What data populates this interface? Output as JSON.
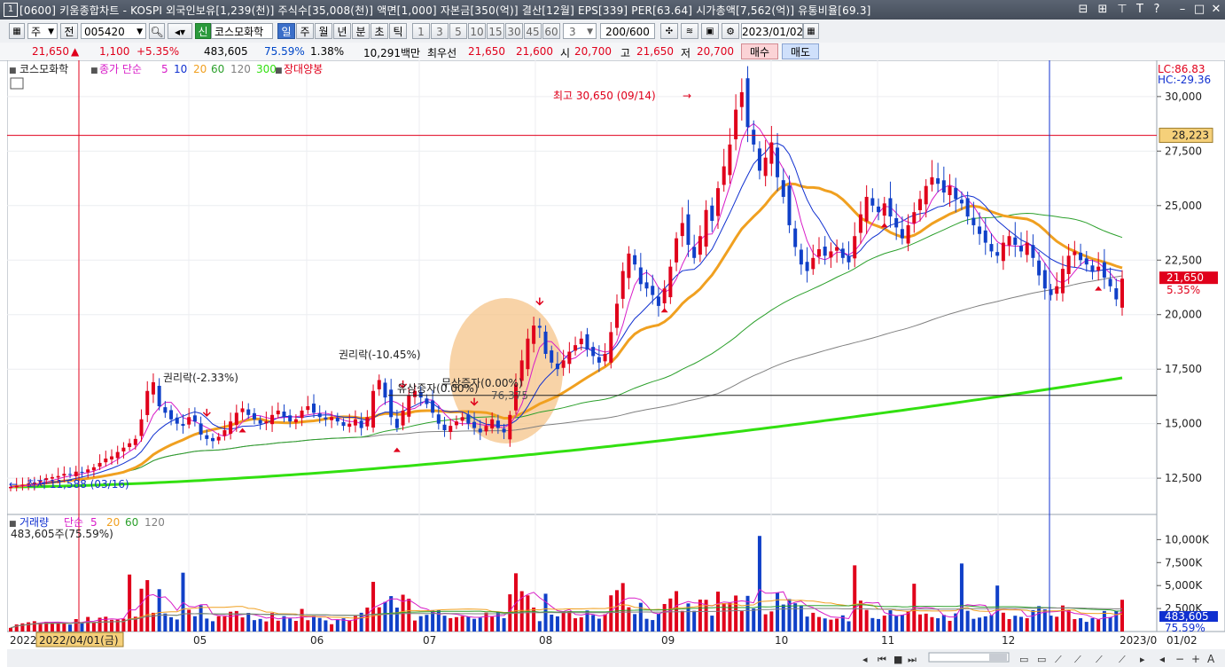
{
  "titlebar": {
    "number": "1",
    "title": "[0600] 키움종합차트 - KOSPI 외국인보유[1,239(천)] 주식수[35,008(천)] 액면[1,000] 자본금[350(억)] 결산[12월] EPS[339] PER[63.64] 시가총액[7,562(억)] 유통비율[69.3]"
  },
  "toolbar": {
    "period_unit": "주",
    "prev_label": "전",
    "code": "005420",
    "credit_label": "신",
    "stock_name": "코스모화학",
    "tabs": [
      "일",
      "주",
      "월",
      "년",
      "분",
      "초",
      "틱"
    ],
    "active_tab": "일",
    "intervals": [
      "1",
      "3",
      "5",
      "10",
      "15",
      "30",
      "45",
      "60"
    ],
    "interval_custom": "3",
    "count": "200",
    "count_max": "/600",
    "date": "2023/01/02"
  },
  "pricebar": {
    "price": "21,650",
    "change": "1,100",
    "change_pct": "+5.35%",
    "volume": "483,605",
    "volume_ratio": "75.59%",
    "turnover": "1.38%",
    "amount": "10,291백만",
    "best_label": "최우선",
    "ask": "21,650",
    "bid": "21,600",
    "open_label": "시",
    "open": "20,700",
    "high_label": "고",
    "high": "21,650",
    "low_label": "저",
    "low": "20,700",
    "buy_label": "매수",
    "sell_label": "매도"
  },
  "legend": {
    "name": "코스모화학",
    "ma_label": "종가 단순",
    "ma_periods": [
      "5",
      "10",
      "20",
      "60",
      "120",
      "300"
    ],
    "candle_type": "장대양봉"
  },
  "vol_legend": {
    "name": "거래량",
    "ma_label": "단순",
    "ma_periods": [
      "5",
      "20",
      "60",
      "120"
    ],
    "current": "483,605주(75.59%)"
  },
  "right_info": {
    "lc": "LC:86.83",
    "hc": "HC:-29.36",
    "hline_value": "28,223",
    "last_price": "21,650",
    "last_pct": "5.35%",
    "last_volume": "483,605",
    "last_vol_pct": "75.59%"
  },
  "annotations": {
    "max": "최고 30,650 (09/14)",
    "min": "최저 11,588 (03/16)",
    "rights1": "권리락(-2.33%)",
    "rights2": "권리락(-10.45%)",
    "rights_issue": "유상증자(0.00%)",
    "bonus_issue": "무상증자(0.00%)",
    "bonus_val": "76,375"
  },
  "x_axis": {
    "start": "2022",
    "cursor_date": "2022/04/01(금)",
    "months": [
      "05",
      "06",
      "07",
      "08",
      "09",
      "10",
      "11",
      "12"
    ],
    "end1": "2023/0",
    "end2": "01/02"
  },
  "colors": {
    "up": "#e0001b",
    "down": "#1040c8",
    "ma5": "#d81cc8",
    "ma10": "#1030d0",
    "ma20": "#f0a020",
    "ma60": "#2ca02c",
    "ma120": "#808080",
    "ma300": "#32e010"
  },
  "chart_data": {
    "type": "candlestick",
    "ylim": [
      11000,
      31500
    ],
    "yticks": [
      12500,
      15000,
      17500,
      20000,
      22500,
      25000,
      27500,
      30000
    ],
    "ytick_labels": [
      "12,500",
      "15,000",
      "17,500",
      "20,000",
      "22,500",
      "25,000",
      "27,500",
      "30,000"
    ],
    "hline": 28223,
    "support_line": 16300,
    "closes": [
      12100,
      12150,
      12200,
      12250,
      12300,
      12400,
      12500,
      12550,
      12600,
      12700,
      12650,
      12800,
      12750,
      12900,
      13000,
      13200,
      13400,
      13500,
      13700,
      13900,
      14100,
      14300,
      15200,
      16500,
      16900,
      15800,
      15500,
      15200,
      15000,
      14900,
      15300,
      15100,
      14500,
      14300,
      14200,
      14400,
      14700,
      15100,
      15500,
      15700,
      15400,
      15200,
      15000,
      15100,
      15400,
      15600,
      15300,
      15100,
      15200,
      15600,
      15800,
      15500,
      15300,
      15200,
      15300,
      15100,
      14900,
      15000,
      15200,
      14800,
      15300,
      16500,
      17000,
      16200,
      15300,
      14800,
      15600,
      16300,
      16500,
      16200,
      15900,
      15500,
      15000,
      14700,
      14900,
      15100,
      15300,
      15000,
      14800,
      14600,
      14900,
      15200,
      14800,
      14600,
      15400,
      16800,
      17900,
      18900,
      19500,
      19400,
      18200,
      17800,
      17500,
      17900,
      18300,
      18600,
      18900,
      18400,
      18100,
      17800,
      18200,
      19200,
      20500,
      22000,
      22800,
      22300,
      21400,
      21200,
      20900,
      20400,
      21200,
      22200,
      23500,
      24200,
      23200,
      22600,
      23600,
      24800,
      24300,
      25800,
      26800,
      27800,
      29400,
      30200,
      28600,
      27800,
      26600,
      27200,
      27900,
      26300,
      25400,
      24100,
      23100,
      22300,
      22000,
      22600,
      23000,
      22700,
      22900,
      23100,
      22600,
      22400,
      23600,
      24600,
      25400,
      25000,
      24700,
      25100,
      24500,
      24000,
      23500,
      24100,
      24700,
      25300,
      25900,
      26300,
      26000,
      25600,
      25900,
      25300,
      25100,
      24500,
      24100,
      23700,
      23300,
      22900,
      22700,
      23300,
      23600,
      23200,
      22900,
      23300,
      22600,
      21800,
      21200,
      20900,
      21300,
      22100,
      22700,
      22900,
      22500,
      22300,
      22000,
      22200,
      21700,
      21300,
      20700,
      21650
    ]
  }
}
